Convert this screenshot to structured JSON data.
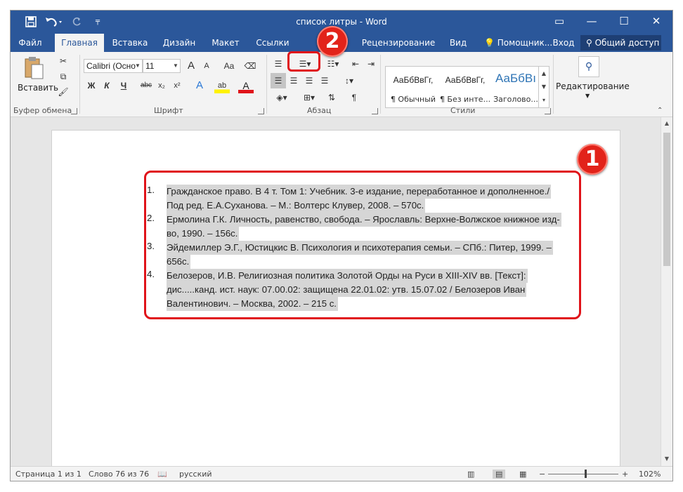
{
  "titlebar": {
    "title": "список литры - Word",
    "save_icon": "save-icon",
    "undo_icon": "undo-icon",
    "redo_icon": "redo-icon",
    "customize_icon": "customize-icon",
    "restore_label": "▭",
    "minimize_label": "—",
    "maximize_label": "☐",
    "close_label": "✕"
  },
  "menu": {
    "tabs": [
      "Файл",
      "Главная",
      "Вставка",
      "Дизайн",
      "Макет",
      "Ссылки",
      "Ра",
      "Рецензирование",
      "Вид"
    ],
    "tell_me": "Помощник...",
    "signin": "Вход",
    "share": "Общий доступ"
  },
  "ribbon": {
    "clipboard": {
      "label": "Буфер обмена",
      "paste": "Вставить"
    },
    "font": {
      "label": "Шрифт",
      "font_name": "Calibri (Осно",
      "font_size": "11",
      "grow": "A",
      "shrink": "A",
      "case": "Aa",
      "bold": "Ж",
      "italic": "К",
      "underline": "Ч",
      "strike": "abc",
      "subscript": "x₂",
      "superscript": "x²",
      "effects": "A",
      "highlight": "ab",
      "color": "A"
    },
    "paragraph": {
      "label": "Абзац"
    },
    "styles": {
      "label": "Стили",
      "items": [
        {
          "sample": "АаБбВвГг,",
          "name": "¶ Обычный"
        },
        {
          "sample": "АаБбВвГг,",
          "name": "¶ Без инте..."
        },
        {
          "sample": "АаБбВı",
          "name": "Заголово..."
        }
      ]
    },
    "editing": {
      "label": "Редактирование"
    }
  },
  "document": {
    "items": [
      {
        "num": "1.",
        "lines": [
          "Гражданское право. В 4 т. Том 1: Учебник. 3-е издание, переработанное и дополненное./",
          "Под ред. Е.А.Суханова. – М.: Волтерс Клувер, 2008. – 570с."
        ]
      },
      {
        "num": "2.",
        "lines": [
          "Ермолина Г.К. Личность, равенство, свобода. – Ярославль: Верхне-Волжское книжное изд-",
          "во, 1990. – 156с."
        ]
      },
      {
        "num": "3.",
        "lines": [
          "Эйдемиллер Э.Г., Юстицкис В. Психология и психотерапия семьи. – СПб.: Питер, 1999. –",
          "656с."
        ]
      },
      {
        "num": "4.",
        "lines": [
          "Белозеров, И.В. Религиозная политика Золотой Орды на Руси в XIII-XIV вв. [Текст]:",
          "дис.....канд. ист. наук: 07.00.02: защищена 22.01.02: утв. 15.07.02 / Белозеров Иван",
          "Валентинович. – Москва, 2002. – 215 с."
        ]
      }
    ]
  },
  "annotations": {
    "badge1": "1",
    "badge2": "2",
    "color": "#e0141a"
  },
  "status": {
    "page": "Страница 1 из 1",
    "words": "Слово 76 из 76",
    "language": "русский",
    "zoom": "102%",
    "minus": "−",
    "plus": "+"
  },
  "colors": {
    "accent": "#2b579a",
    "selection": "#d6d6d6"
  }
}
